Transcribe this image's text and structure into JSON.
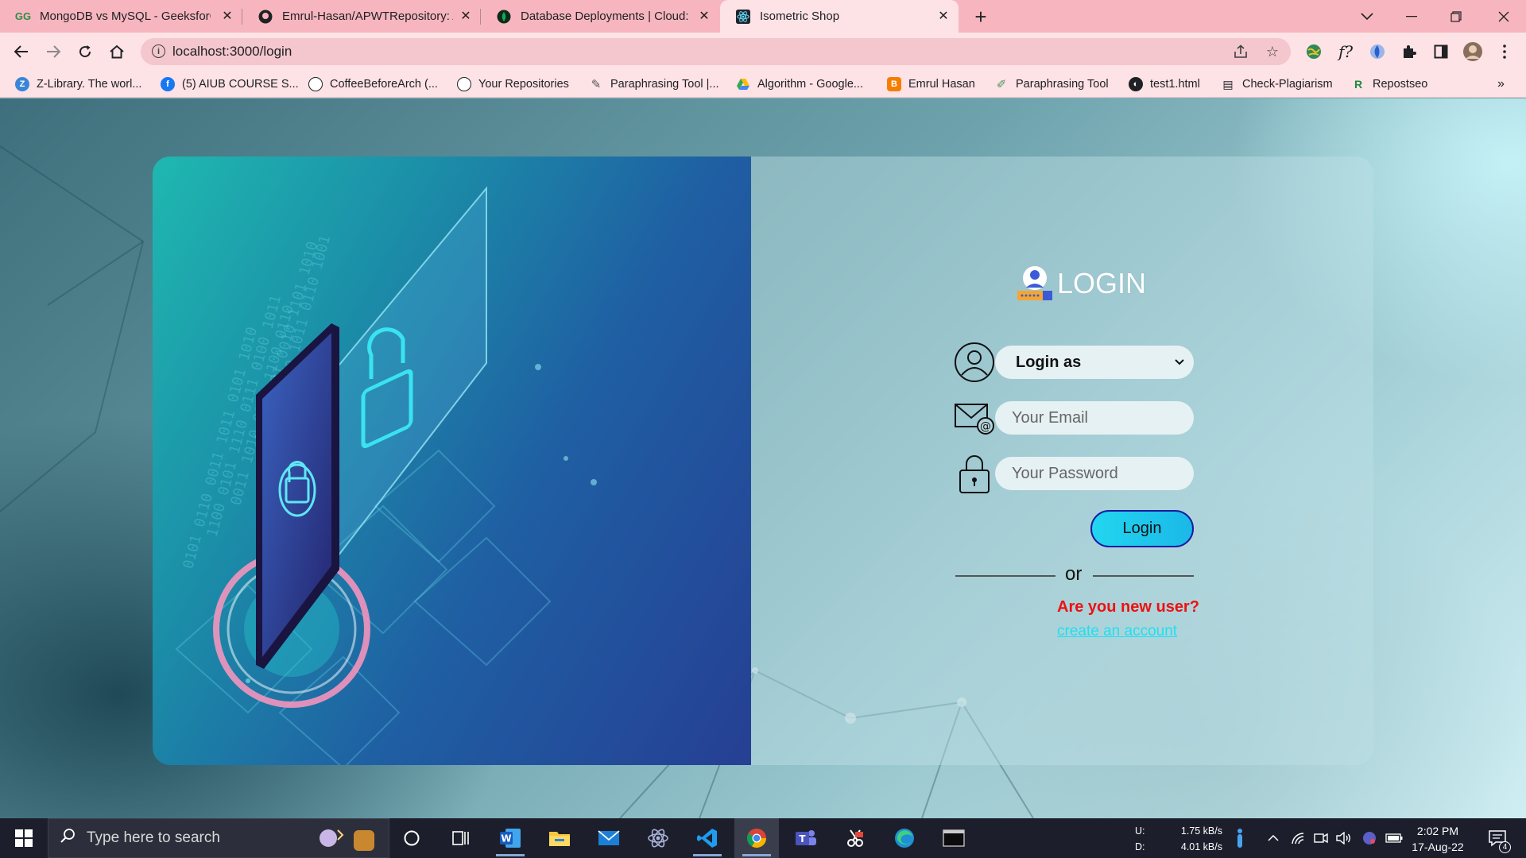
{
  "browser": {
    "tabs": [
      {
        "title": "MongoDB vs MySQL - GeeksforG",
        "favicon": "geeksforgeeks-icon",
        "active": false
      },
      {
        "title": "Emrul-Hasan/APWTRepository: A",
        "favicon": "github-icon",
        "active": false
      },
      {
        "title": "Database Deployments | Cloud: M",
        "favicon": "mongodb-leaf-icon",
        "active": false
      },
      {
        "title": "Isometric Shop",
        "favicon": "react-icon",
        "active": true
      }
    ],
    "url": "localhost:3000/login",
    "bookmarks": [
      {
        "label": "Z-Library. The worl...",
        "icon": "zlibrary-icon",
        "color": "#3a86d6"
      },
      {
        "label": "(5) AIUB COURSE S...",
        "icon": "facebook-icon",
        "color": "#1877f2"
      },
      {
        "label": "CoffeeBeforeArch (...",
        "icon": "github-icon",
        "color": "#ffffff"
      },
      {
        "label": "Your Repositories",
        "icon": "github-icon",
        "color": "#ffffff"
      },
      {
        "label": "Paraphrasing Tool |...",
        "icon": "feather-icon",
        "color": "#555555"
      },
      {
        "label": "Algorithm - Google...",
        "icon": "google-drive-icon",
        "color": "#34a853"
      },
      {
        "label": "Emrul Hasan",
        "icon": "blogger-icon",
        "color": "#f57d00"
      },
      {
        "label": "Paraphrasing Tool",
        "icon": "quillbot-icon",
        "color": "#499557"
      },
      {
        "label": "test1.html",
        "icon": "globe-icon",
        "color": "#202124"
      },
      {
        "label": "Check-Plagiarism",
        "icon": "document-icon",
        "color": "#202124"
      },
      {
        "label": "Repostseo",
        "icon": "repostseo-icon",
        "color": "#1f8b3f"
      }
    ]
  },
  "login": {
    "title": "LOGIN",
    "role_select": "Login as",
    "email_placeholder": "Your Email",
    "password_placeholder": "Your Password",
    "submit": "Login",
    "divider": "or",
    "new_user_prompt": "Are you new user?",
    "create_account": "create an account"
  },
  "taskbar": {
    "search_placeholder": "Type here to search",
    "net_up_label": "U:",
    "net_down_label": "D:",
    "net_up": "1.75 kB/s",
    "net_down": "4.01 kB/s",
    "time": "2:02 PM",
    "date": "17-Aug-22",
    "notifications": "4"
  },
  "colors": {
    "tabbar": "#f7b6bf",
    "toolbar": "#fde2e6",
    "login_button": "#22d6f0",
    "new_user_text": "#ee1111",
    "link": "#1ee0f0"
  }
}
